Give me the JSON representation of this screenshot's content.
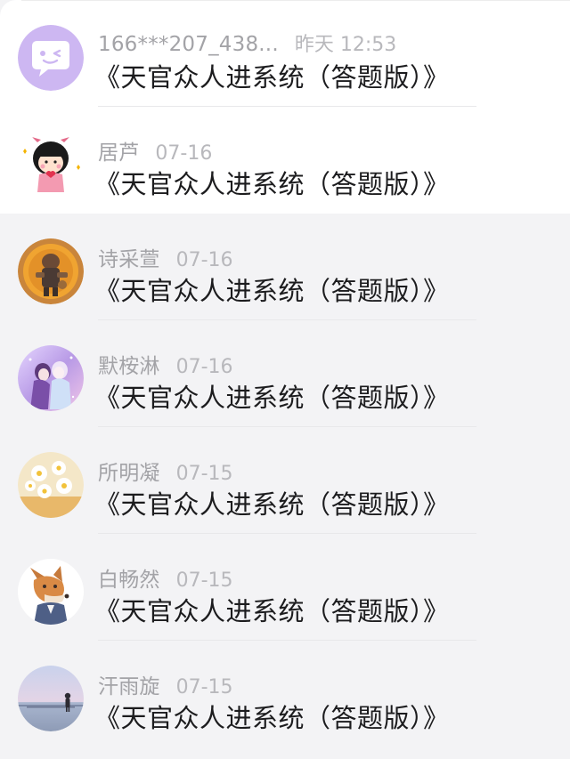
{
  "messages": [
    {
      "name": "166***207_438...",
      "time": "昨天 12:53",
      "title": "《天官众人进系统（答题版）》",
      "avatar": "wink-face-bubble-avatar"
    },
    {
      "name": "居芦",
      "time": "07-16",
      "title": "《天官众人进系统（答题版）》",
      "avatar": "cartoon-girl-heart-avatar"
    },
    {
      "name": "诗采萱",
      "time": "07-16",
      "title": "《天官众人进系统（答题版）》",
      "avatar": "adventurer-figure-avatar"
    },
    {
      "name": "默桉淋",
      "time": "07-16",
      "title": "《天官众人进系统（答题版）》",
      "avatar": "anime-couple-avatar"
    },
    {
      "name": "所明凝",
      "time": "07-15",
      "title": "《天官众人进系统（答题版）》",
      "avatar": "daisy-flowers-avatar"
    },
    {
      "name": "白畅然",
      "time": "07-15",
      "title": "《天官众人进系统（答题版）》",
      "avatar": "fox-character-avatar"
    },
    {
      "name": "汗雨旋",
      "time": "07-15",
      "title": "《天官众人进系统（答题版）》",
      "avatar": "seaside-figure-avatar"
    }
  ],
  "colors": {
    "accent_avatar": "#cdb7f2",
    "name_text": "#a3a3a7",
    "time_text": "#b8b8bc",
    "title_text": "#1c1c1e"
  }
}
